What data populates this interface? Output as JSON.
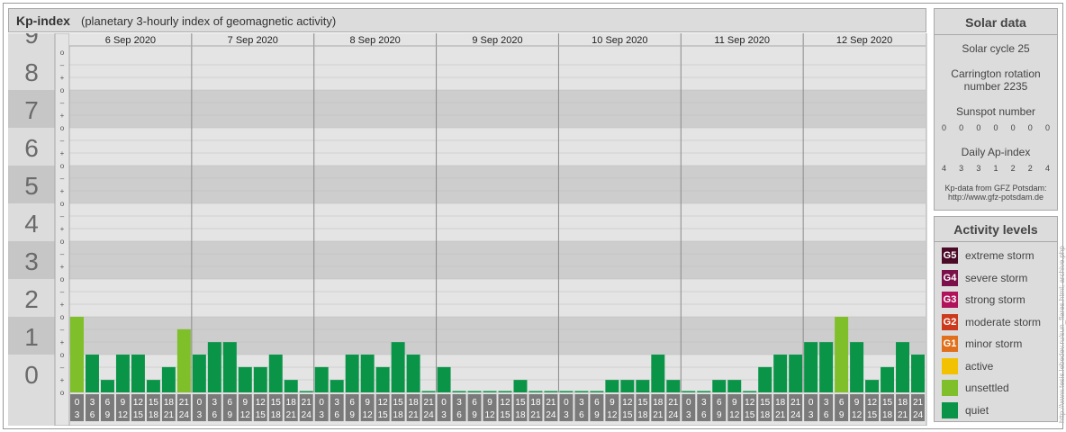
{
  "header": {
    "title": "Kp-index",
    "subtitle": "(planetary 3-hourly index of geomagnetic activity)"
  },
  "solar": {
    "title": "Solar data",
    "cycle": "Solar cycle 25",
    "carrington_line1": "Carrington rotation",
    "carrington_line2": "number 2235",
    "sunspot_title": "Sunspot number",
    "sunspot_values": [
      "0",
      "0",
      "0",
      "0",
      "0",
      "0",
      "0"
    ],
    "ap_title": "Daily Ap-index",
    "ap_values": [
      "4",
      "3",
      "3",
      "1",
      "2",
      "2",
      "4"
    ],
    "source_line1": "Kp-data from GFZ Potsdam:",
    "source_line2": "http://www.gfz-potsdam.de"
  },
  "activity": {
    "title": "Activity levels",
    "levels": [
      {
        "badge": "G5",
        "label": "extreme storm",
        "color": "#4a0a28"
      },
      {
        "badge": "G4",
        "label": "severe storm",
        "color": "#7a0f4a"
      },
      {
        "badge": "G3",
        "label": "strong storm",
        "color": "#b0135a"
      },
      {
        "badge": "G2",
        "label": "moderate storm",
        "color": "#cc3a1e"
      },
      {
        "badge": "G1",
        "label": "minor storm",
        "color": "#e0701c"
      },
      {
        "badge": "",
        "label": "active",
        "color": "#f2c200"
      },
      {
        "badge": "",
        "label": "unsettled",
        "color": "#7fbf2a"
      },
      {
        "badge": "",
        "label": "quiet",
        "color": "#0a9448"
      }
    ]
  },
  "credit": "http://www.tesis.lebedev.ru/sun_flares.html; archive.php",
  "chart_data": {
    "type": "bar",
    "title": "Kp-index",
    "ylim": [
      0,
      9
    ],
    "y_ticks": [
      "0",
      "1",
      "2",
      "3",
      "4",
      "5",
      "6",
      "7",
      "8",
      "9"
    ],
    "sub_ticks": [
      "o",
      "+",
      "–"
    ],
    "days": [
      "6 Sep 2020",
      "7 Sep 2020",
      "8 Sep 2020",
      "9 Sep 2020",
      "10 Sep 2020",
      "11 Sep 2020",
      "12 Sep 2020"
    ],
    "hour_labels_top": [
      "0",
      "3",
      "6",
      "9",
      "12",
      "15",
      "18",
      "21"
    ],
    "hour_labels_bottom": [
      "3",
      "6",
      "9",
      "12",
      "15",
      "18",
      "21",
      "24"
    ],
    "values": [
      [
        2.0,
        1.0,
        0.33,
        1.0,
        1.0,
        0.33,
        0.67,
        1.67
      ],
      [
        1.0,
        1.33,
        1.33,
        0.67,
        0.67,
        1.0,
        0.33,
        0.0
      ],
      [
        0.67,
        0.33,
        1.0,
        1.0,
        0.67,
        1.33,
        1.0,
        0.0
      ],
      [
        0.67,
        0.0,
        0.0,
        0.0,
        0.0,
        0.33,
        0.0,
        0.0
      ],
      [
        0.0,
        0.0,
        0.0,
        0.33,
        0.33,
        0.33,
        1.0,
        0.33
      ],
      [
        0.0,
        0.0,
        0.33,
        0.33,
        0.0,
        0.67,
        1.0,
        1.0
      ],
      [
        1.33,
        1.33,
        2.0,
        1.33,
        0.33,
        0.67,
        1.33,
        1.0
      ]
    ],
    "colors": {
      "quiet": "#0a9448",
      "unsettled": "#7fbf2a",
      "active": "#f2c200"
    }
  }
}
